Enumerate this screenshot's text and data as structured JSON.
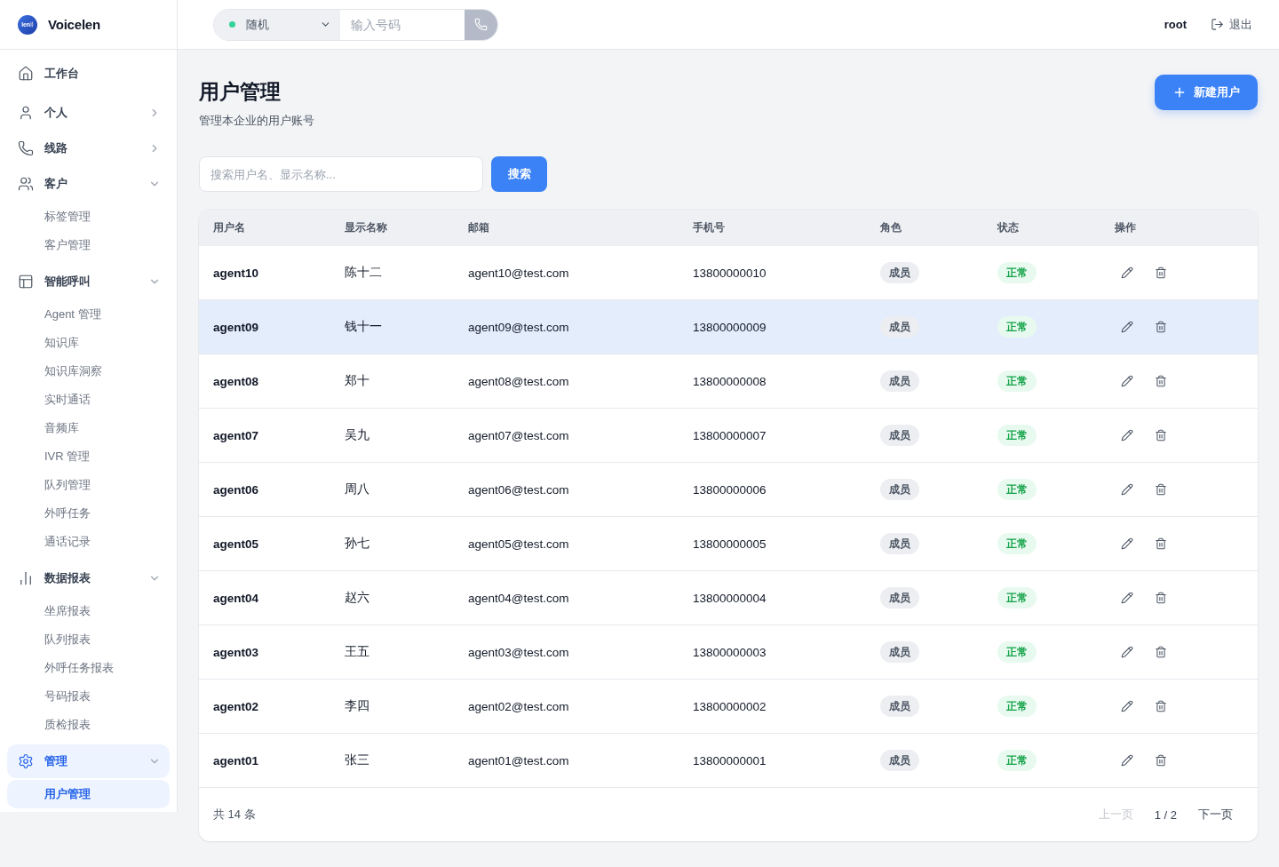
{
  "brand": {
    "mark": "len",
    "name": "Voicelen"
  },
  "sidebar": {
    "items": [
      {
        "kind": "link",
        "label": "工作台",
        "selected": false
      },
      {
        "kind": "group",
        "label": "个人",
        "selected": false,
        "expanded": false
      },
      {
        "kind": "group",
        "label": "线路",
        "selected": false,
        "expanded": false
      },
      {
        "kind": "group",
        "label": "客户",
        "selected": false,
        "expanded": true,
        "children": [
          {
            "label": "标签管理",
            "selected": false
          },
          {
            "label": "客户管理",
            "selected": false
          }
        ]
      },
      {
        "kind": "group",
        "label": "智能呼叫",
        "selected": false,
        "expanded": true,
        "children": [
          {
            "label": "Agent 管理",
            "selected": false
          },
          {
            "label": "知识库",
            "selected": false
          },
          {
            "label": "知识库洞察",
            "selected": false
          },
          {
            "label": "实时通话",
            "selected": false
          },
          {
            "label": "音频库",
            "selected": false
          },
          {
            "label": "IVR 管理",
            "selected": false
          },
          {
            "label": "队列管理",
            "selected": false
          },
          {
            "label": "外呼任务",
            "selected": false
          },
          {
            "label": "通话记录",
            "selected": false
          }
        ]
      },
      {
        "kind": "group",
        "label": "数据报表",
        "selected": false,
        "expanded": true,
        "children": [
          {
            "label": "坐席报表",
            "selected": false
          },
          {
            "label": "队列报表",
            "selected": false
          },
          {
            "label": "外呼任务报表",
            "selected": false
          },
          {
            "label": "号码报表",
            "selected": false
          },
          {
            "label": "质检报表",
            "selected": false
          }
        ]
      },
      {
        "kind": "group",
        "label": "管理",
        "selected": true,
        "expanded": true,
        "children": [
          {
            "label": "用户管理",
            "selected": true
          }
        ]
      }
    ]
  },
  "dialer": {
    "line": {
      "value": "随机",
      "online": true
    },
    "number": {
      "placeholder": "输入号码"
    }
  },
  "user": {
    "name": "root",
    "logout": "退出"
  },
  "page": {
    "title": "用户管理",
    "subtitle": "管理本企业的用户账号",
    "new_button": "新建用户"
  },
  "search": {
    "placeholder": "搜索用户名、显示名称...",
    "button": "搜索"
  },
  "table": {
    "columns": [
      "用户名",
      "显示名称",
      "邮箱",
      "手机号",
      "角色",
      "状态",
      "操作"
    ],
    "rows": [
      {
        "username": "agent10",
        "display_name": "陈十二",
        "email": "agent10@test.com",
        "phone": "13800000010",
        "role": "成员",
        "status": "正常",
        "selected": false
      },
      {
        "username": "agent09",
        "display_name": "钱十一",
        "email": "agent09@test.com",
        "phone": "13800000009",
        "role": "成员",
        "status": "正常",
        "selected": true
      },
      {
        "username": "agent08",
        "display_name": "郑十",
        "email": "agent08@test.com",
        "phone": "13800000008",
        "role": "成员",
        "status": "正常",
        "selected": false
      },
      {
        "username": "agent07",
        "display_name": "吴九",
        "email": "agent07@test.com",
        "phone": "13800000007",
        "role": "成员",
        "status": "正常",
        "selected": false
      },
      {
        "username": "agent06",
        "display_name": "周八",
        "email": "agent06@test.com",
        "phone": "13800000006",
        "role": "成员",
        "status": "正常",
        "selected": false
      },
      {
        "username": "agent05",
        "display_name": "孙七",
        "email": "agent05@test.com",
        "phone": "13800000005",
        "role": "成员",
        "status": "正常",
        "selected": false
      },
      {
        "username": "agent04",
        "display_name": "赵六",
        "email": "agent04@test.com",
        "phone": "13800000004",
        "role": "成员",
        "status": "正常",
        "selected": false
      },
      {
        "username": "agent03",
        "display_name": "王五",
        "email": "agent03@test.com",
        "phone": "13800000003",
        "role": "成员",
        "status": "正常",
        "selected": false
      },
      {
        "username": "agent02",
        "display_name": "李四",
        "email": "agent02@test.com",
        "phone": "13800000002",
        "role": "成员",
        "status": "正常",
        "selected": false
      },
      {
        "username": "agent01",
        "display_name": "张三",
        "email": "agent01@test.com",
        "phone": "13800000001",
        "role": "成员",
        "status": "正常",
        "selected": false
      }
    ]
  },
  "footer": {
    "total": "共 14 条",
    "prev": {
      "label": "上一页",
      "disabled": true
    },
    "page": "1 / 2",
    "next": {
      "label": "下一页",
      "disabled": false
    }
  }
}
